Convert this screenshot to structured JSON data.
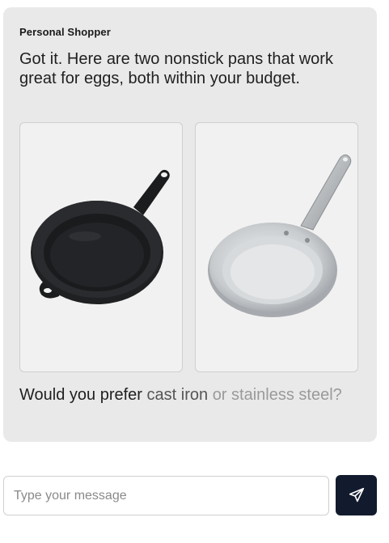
{
  "chat": {
    "sender": "Personal Shopper",
    "message": "Got it. Here are two nonstick pans that work great for eggs, both within your budget.",
    "question_words": [
      {
        "text": "Would",
        "tone": "dark"
      },
      {
        "text": "you",
        "tone": "dark"
      },
      {
        "text": "prefer",
        "tone": "dark"
      },
      {
        "text": "cast",
        "tone": "mid"
      },
      {
        "text": "iron",
        "tone": "mid"
      },
      {
        "text": "or",
        "tone": "light"
      },
      {
        "text": "stainless",
        "tone": "light"
      },
      {
        "text": "steel?",
        "tone": "light"
      }
    ],
    "products": [
      {
        "image": "cast-iron-skillet"
      },
      {
        "image": "stainless-steel-frying-pan"
      }
    ]
  },
  "composer": {
    "placeholder": "Type your message",
    "value": "",
    "send_icon": "paper-plane-icon"
  },
  "colors": {
    "card_background": "#e9e9e9",
    "send_button": "#121b2e",
    "cast_iron": "#1b1c1e",
    "steel": "#c9cccf"
  }
}
